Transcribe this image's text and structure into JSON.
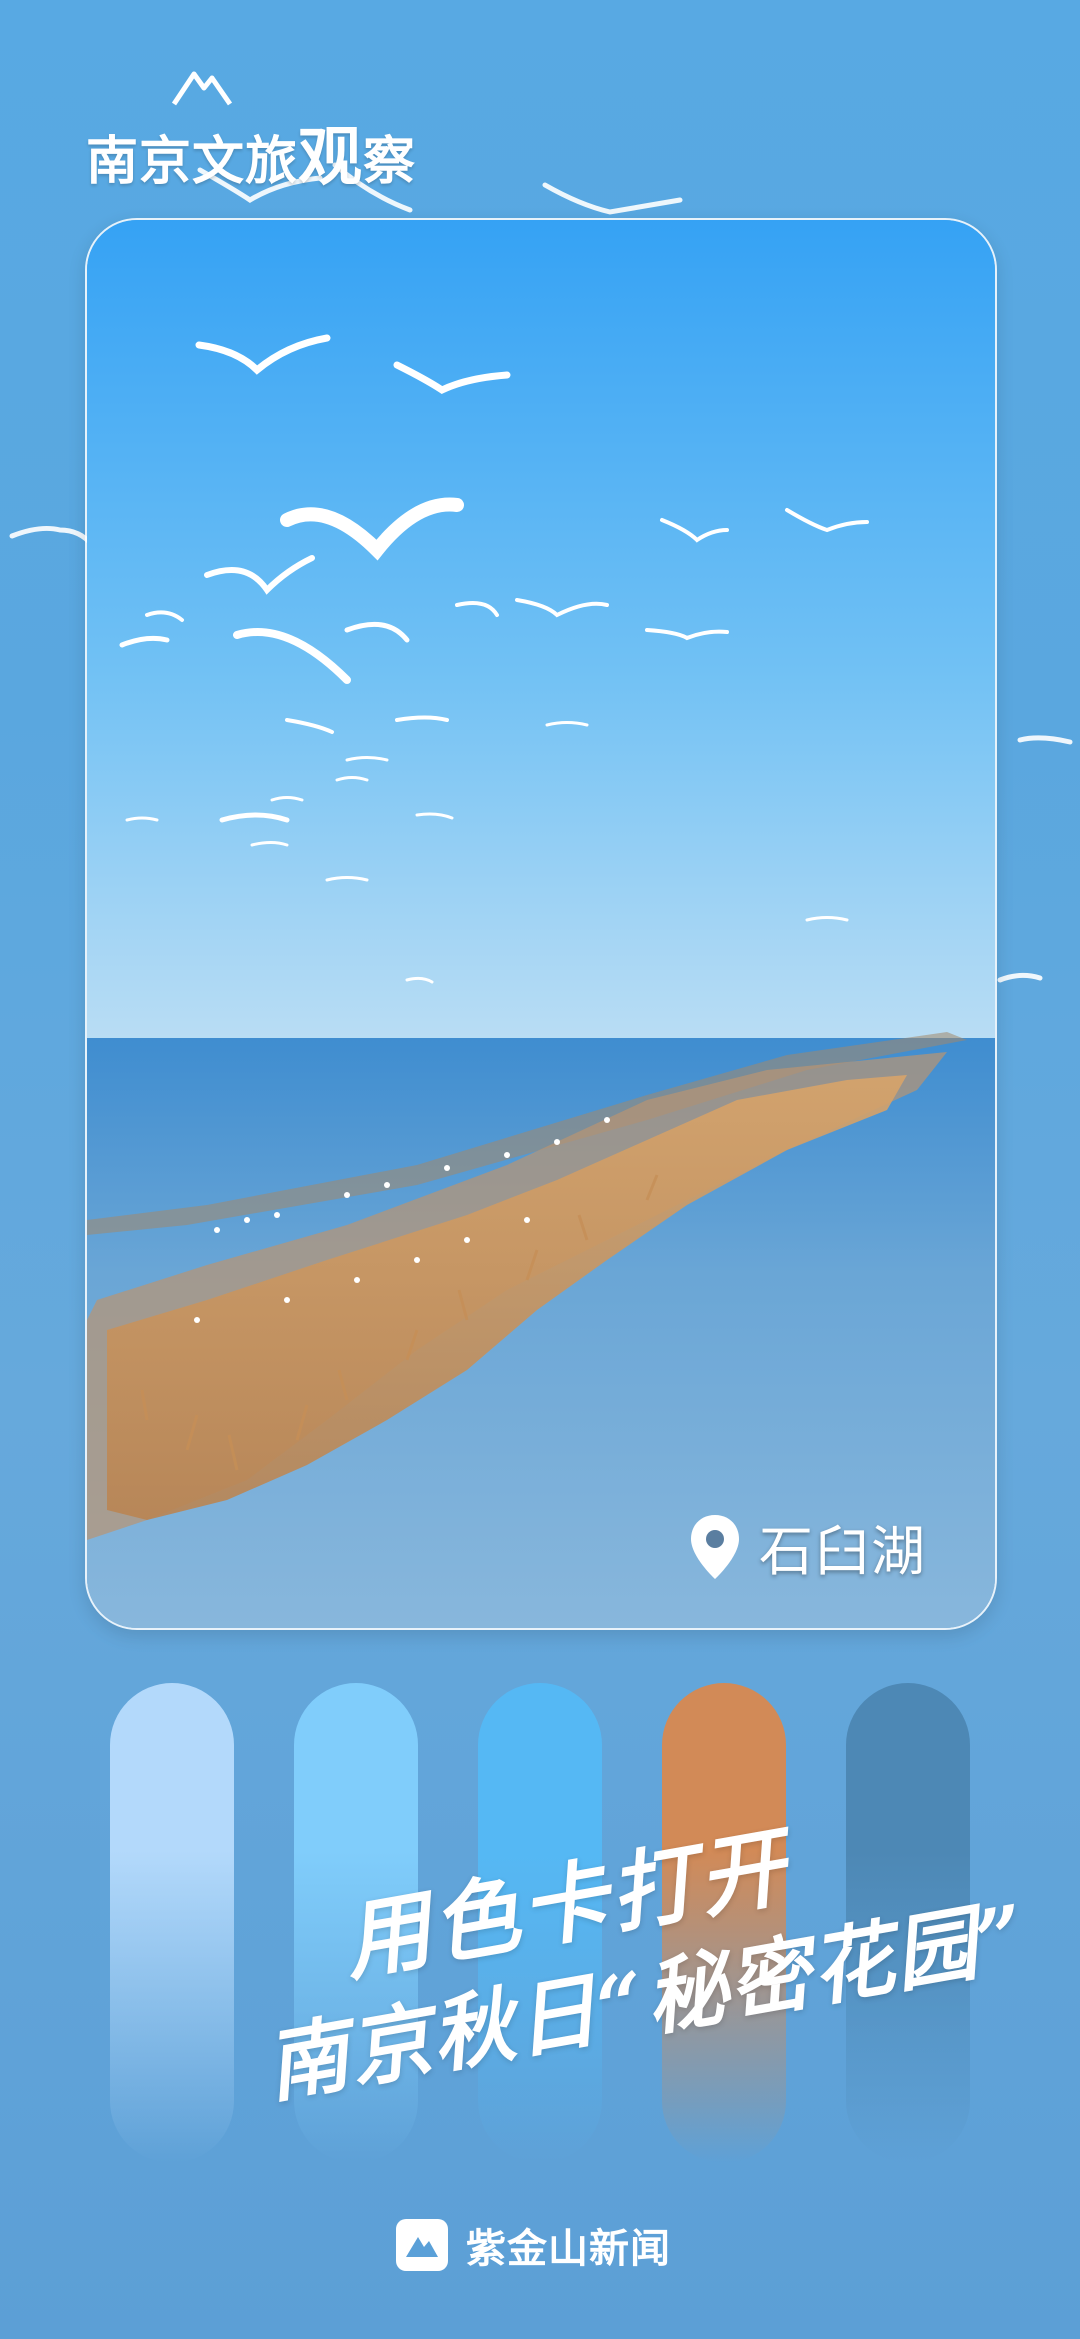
{
  "header": {
    "brand_prefix": "南京文旅",
    "brand_highlight": "观",
    "brand_suffix": "察"
  },
  "photo": {
    "location_label": "石臼湖",
    "location_icon": "map-pin-icon"
  },
  "palette": {
    "colors": [
      "#b3d9fb",
      "#80cdfb",
      "#55b8f4",
      "#d28a57",
      "#4d88b5"
    ]
  },
  "headline": {
    "line1": "用色卡打开",
    "line2": "南京秋日“秘密花园”"
  },
  "footer": {
    "logo_icon": "mountain-logo-icon",
    "brand": "紫金山新闻"
  }
}
